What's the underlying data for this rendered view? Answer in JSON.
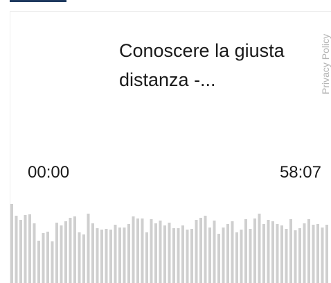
{
  "player": {
    "title": "Conoscere la giusta distanza -...",
    "current_time": "00:00",
    "duration": "58:07",
    "progress": 0
  },
  "sidebar": {
    "privacy_label": "Privacy Policy"
  },
  "waveform": {
    "levels": [
      0.97,
      0.82,
      0.77,
      0.83,
      0.84,
      0.73,
      0.52,
      0.61,
      0.63,
      0.51,
      0.74,
      0.7,
      0.75,
      0.8,
      0.81,
      0.62,
      0.59,
      0.85,
      0.73,
      0.67,
      0.65,
      0.66,
      0.65,
      0.71,
      0.68,
      0.68,
      0.72,
      0.81,
      0.79,
      0.79,
      0.62,
      0.78,
      0.73,
      0.76,
      0.7,
      0.74,
      0.67,
      0.67,
      0.7,
      0.65,
      0.66,
      0.77,
      0.8,
      0.82,
      0.68,
      0.76,
      0.6,
      0.68,
      0.72,
      0.75,
      0.62,
      0.65,
      0.78,
      0.66,
      0.79,
      0.85,
      0.72,
      0.77,
      0.75,
      0.72,
      0.7,
      0.66,
      0.78,
      0.64,
      0.67,
      0.73,
      0.78,
      0.71,
      0.72,
      0.68,
      0.71
    ]
  }
}
